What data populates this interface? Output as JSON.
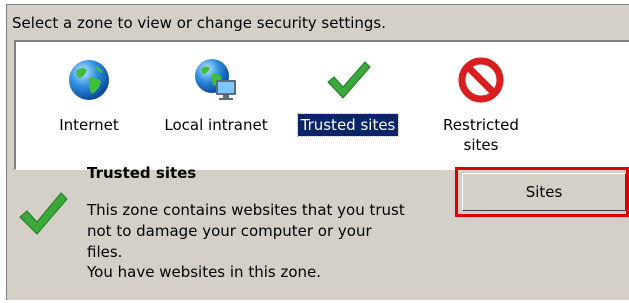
{
  "prompt": "Select a zone to view or change security settings.",
  "zones": [
    {
      "icon": "globe-icon",
      "label": "Internet",
      "label2": ""
    },
    {
      "icon": "local-intranet-icon",
      "label": "Local intranet",
      "label2": ""
    },
    {
      "icon": "checkmark-icon",
      "label": "Trusted sites",
      "label2": ""
    },
    {
      "icon": "restricted-icon",
      "label": "Restricted",
      "label2": "sites"
    }
  ],
  "selected_zone": "Trusted sites",
  "detail": {
    "icon": "checkmark-icon",
    "title": "Trusted sites",
    "description": "This zone contains websites that you trust not to damage your computer or your files.",
    "status": "You have websites in this zone."
  },
  "sites_button": "Sites",
  "colors": {
    "selection": "#0a246a",
    "highlight_box": "#e00000",
    "panel": "#d4d0c8",
    "check_green": "#3aa83a",
    "restricted_red": "#d81e1e"
  }
}
